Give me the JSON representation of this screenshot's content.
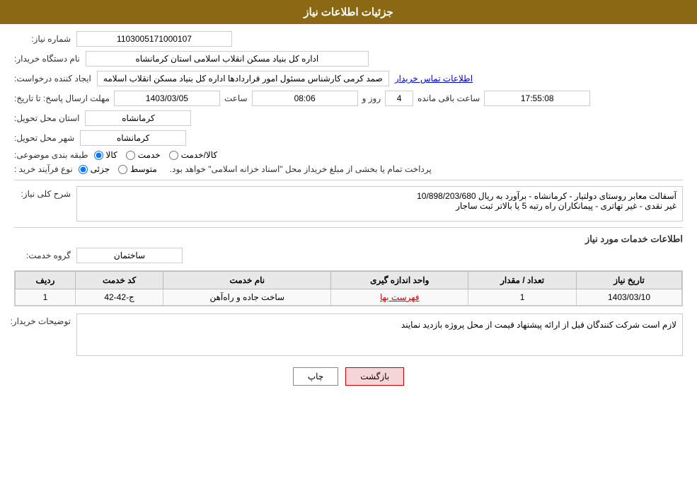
{
  "header": {
    "title": "جزئیات اطلاعات نیاز"
  },
  "fields": {
    "shomara_niaz_label": "شماره نیاز:",
    "shomara_niaz_value": "1103005171000107",
    "nam_dastgah_label": "نام دستگاه خریدار:",
    "nam_dastgah_value": "اداره کل بنیاد مسکن انقلاب اسلامی استان کرمانشاه",
    "ijad_konande_label": "ایجاد کننده درخواست:",
    "ijad_konande_value": "صمد کرمی کارشناس مسئول امور قراردادها اداره کل بنیاد مسکن انقلاب اسلامه",
    "contact_link": "اطلاعات تماس خریدار",
    "mohlat_label": "مهلت ارسال پاسخ: تا تاریخ:",
    "date_value": "1403/03/05",
    "time_label": "ساعت",
    "time_value": "08:06",
    "days_label": "روز و",
    "days_value": "4",
    "remaining_label": "ساعت باقی مانده",
    "remaining_value": "17:55:08",
    "ostan_label": "استان محل تحویل:",
    "ostan_value": "کرمانشاه",
    "shahr_label": "شهر محل تحویل:",
    "shahr_value": "کرمانشاه",
    "tabaghe_label": "طبقه بندی موضوعی:",
    "category_kala": "کالا",
    "category_khedmat": "خدمت",
    "category_kala_khedmat": "کالا/خدمت",
    "category_selected": "kala",
    "nooe_farayand_label": "نوع فرآیند خرید :",
    "process_jozvi": "جزئی",
    "process_motavaset": "متوسط",
    "process_note": "پرداخت تمام یا بخشی از مبلغ خریداز محل \"اسناد خزانه اسلامی\" خواهد بود.",
    "sharh_label": "شرح کلی نیاز:",
    "sharh_value": "آسفالت معابر روستای دولتیار - کرمانشاه - برآورد به ریال  10/898/203/680\nغیر نقدی - غیر تهاتری - پیمانکاران راه رتبه 5 یا بالاتر ثبت ساجار",
    "services_title": "اطلاعات خدمات مورد نیاز",
    "group_label": "گروه خدمت:",
    "group_value": "ساختمان",
    "table_headers": {
      "radif": "ردیف",
      "code": "کد خدمت",
      "name": "نام خدمت",
      "unit": "واحد اندازه گیری",
      "count": "تعداد / مقدار",
      "date": "تاریخ نیاز"
    },
    "table_rows": [
      {
        "radif": "1",
        "code": "ج-42-42",
        "name": "ساخت جاده و راه‌آهن",
        "unit": "فهرست بها",
        "count": "1",
        "date": "1403/03/10"
      }
    ],
    "description_label": "توضیحات خریدار:",
    "description_value": "لازم است شرکت کنندگان قبل از ارائه پیشنهاد قیمت از محل پروژه بازدید نمایند",
    "btn_print": "چاپ",
    "btn_back": "بازگشت"
  }
}
